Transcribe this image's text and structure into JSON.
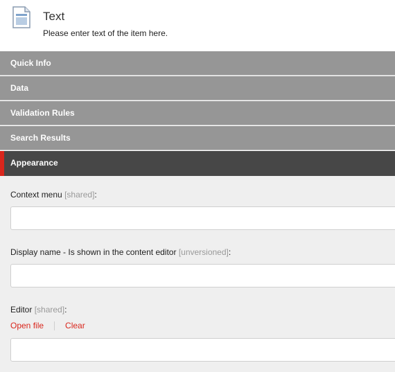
{
  "header": {
    "icon": "document-icon",
    "title": "Text",
    "subtitle": "Please enter text of the item here."
  },
  "sections": [
    {
      "label": "Quick Info",
      "active": false
    },
    {
      "label": "Data",
      "active": false
    },
    {
      "label": "Validation Rules",
      "active": false
    },
    {
      "label": "Search Results",
      "active": false
    },
    {
      "label": "Appearance",
      "active": true
    }
  ],
  "fields": {
    "context_menu": {
      "label": "Context menu",
      "meta": "[shared]",
      "suffix": ":",
      "value": ""
    },
    "display_name": {
      "label": "Display name - Is shown in the content editor",
      "meta": "[unversioned]",
      "suffix": ":",
      "value": ""
    },
    "editor": {
      "label": "Editor",
      "meta": "[shared]",
      "suffix": ":",
      "value": "",
      "open_file": "Open file",
      "clear": "Clear"
    }
  },
  "colors": {
    "accent": "#d9261c",
    "section_bg": "#969696",
    "section_active_bg": "#474747",
    "content_bg": "#efefef"
  }
}
